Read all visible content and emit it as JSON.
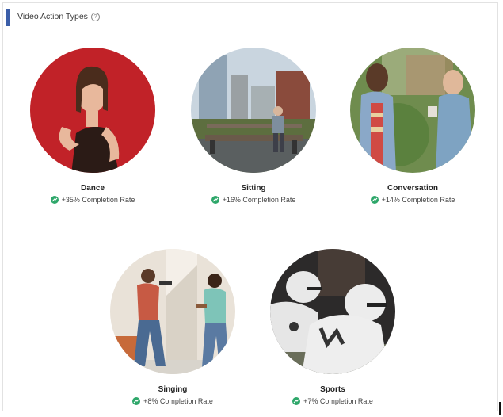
{
  "header": {
    "title": "Video Action Types",
    "help_icon": "?"
  },
  "tiles": [
    {
      "label": "Dance",
      "stat": "+35% Completion Rate",
      "icon": "trend-up-icon"
    },
    {
      "label": "Sitting",
      "stat": "+16% Completion Rate",
      "icon": "trend-up-icon"
    },
    {
      "label": "Conversation",
      "stat": "+14% Completion Rate",
      "icon": "trend-up-icon"
    },
    {
      "label": "Singing",
      "stat": "+8% Completion Rate",
      "icon": "trend-up-icon"
    },
    {
      "label": "Sports",
      "stat": "+7% Completion Rate",
      "icon": "trend-up-icon"
    }
  ],
  "colors": {
    "accent": "#3b5ea8",
    "trend_green": "#2ea76a"
  }
}
